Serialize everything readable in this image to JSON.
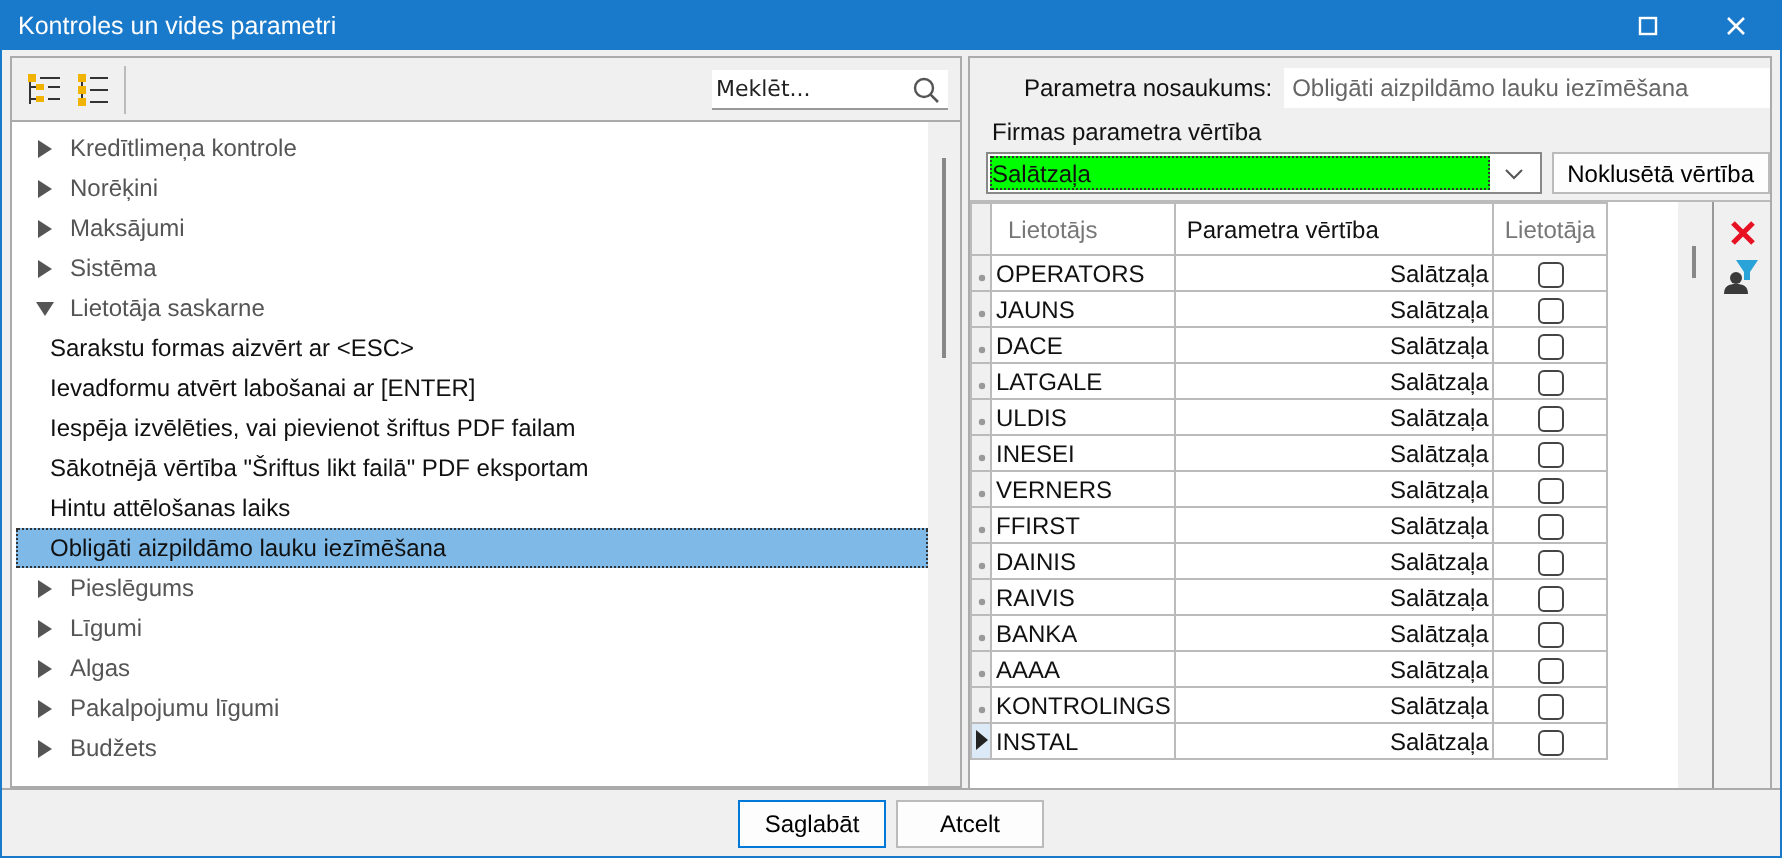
{
  "window": {
    "title": "Kontroles un vides parametri"
  },
  "search": {
    "placeholder": "Meklēt..."
  },
  "tree": [
    {
      "label": "Kredītlimeņa kontrole",
      "expanded": false
    },
    {
      "label": "Norēķini",
      "expanded": false
    },
    {
      "label": "Maksājumi",
      "expanded": false
    },
    {
      "label": "Sistēma",
      "expanded": false
    },
    {
      "label": "Lietotāja saskarne",
      "expanded": true,
      "children": [
        {
          "label": "Sarakstu formas aizvērt ar <ESC>",
          "selected": false
        },
        {
          "label": "Ievadformu atvērt labošanai ar [ENTER]",
          "selected": false
        },
        {
          "label": "Iespēja izvēlēties, vai pievienot šriftus PDF failam",
          "selected": false
        },
        {
          "label": "Sākotnējā vērtība \"Šriftus likt failā\" PDF eksportam",
          "selected": false
        },
        {
          "label": "Hintu attēlošanas laiks",
          "selected": false
        },
        {
          "label": "Obligāti aizpildāmo lauku iezīmēšana",
          "selected": true
        }
      ]
    },
    {
      "label": "Pieslēgums",
      "expanded": false
    },
    {
      "label": "Līgumi",
      "expanded": false
    },
    {
      "label": "Algas",
      "expanded": false
    },
    {
      "label": "Pakalpojumu līgumi",
      "expanded": false
    },
    {
      "label": "Budžets",
      "expanded": false
    }
  ],
  "param_name": {
    "label": "Parametra nosaukums:",
    "value": "Obligāti aizpildāmo lauku iezīmēšana"
  },
  "company_value": {
    "label": "Firmas parametra vērtība",
    "value": "Salātzaļa",
    "color": "#00ff00"
  },
  "default_button": "Noklusētā vērtība",
  "grid": {
    "columns": [
      "Lietotājs",
      "Parametra vērtība",
      "Lietotāja"
    ],
    "rows": [
      {
        "user": "OPERATORS",
        "value": "Salātzaļa",
        "checked": false,
        "current": false
      },
      {
        "user": "JAUNS",
        "value": "Salātzaļa",
        "checked": false,
        "current": false
      },
      {
        "user": "DACE",
        "value": "Salātzaļa",
        "checked": false,
        "current": false
      },
      {
        "user": "LATGALE",
        "value": "Salātzaļa",
        "checked": false,
        "current": false
      },
      {
        "user": "ULDIS",
        "value": "Salātzaļa",
        "checked": false,
        "current": false
      },
      {
        "user": "INESEI",
        "value": "Salātzaļa",
        "checked": false,
        "current": false
      },
      {
        "user": "VERNERS",
        "value": "Salātzaļa",
        "checked": false,
        "current": false
      },
      {
        "user": "FFIRST",
        "value": "Salātzaļa",
        "checked": false,
        "current": false
      },
      {
        "user": "DAINIS",
        "value": "Salātzaļa",
        "checked": false,
        "current": false
      },
      {
        "user": "RAIVIS",
        "value": "Salātzaļa",
        "checked": false,
        "current": false
      },
      {
        "user": "BANKA",
        "value": "Salātzaļa",
        "checked": false,
        "current": false
      },
      {
        "user": "AAAA",
        "value": "Salātzaļa",
        "checked": false,
        "current": false
      },
      {
        "user": "KONTROLINGS",
        "value": "Salātzaļa",
        "checked": false,
        "current": false
      },
      {
        "user": "INSTAL",
        "value": "Salātzaļa",
        "checked": false,
        "current": true
      }
    ]
  },
  "footer_buttons": [
    {
      "label": "Saglabāt",
      "default": true
    },
    {
      "label": "Atcelt",
      "default": false
    }
  ]
}
